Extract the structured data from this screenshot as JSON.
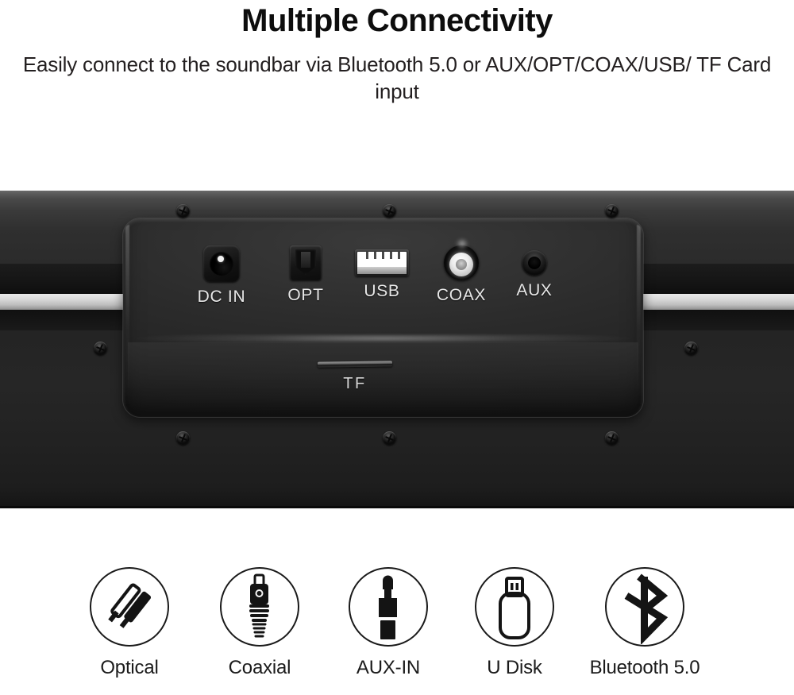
{
  "header": {
    "title": "Multiple Connectivity",
    "subtitle": "Easily connect to the soundbar via Bluetooth 5.0 or AUX/OPT/COAX/USB/ TF Card input"
  },
  "device": {
    "name": "soundbar-rear-panel",
    "ports": [
      {
        "id": "dc-in",
        "label": "DC IN",
        "icon": "dc-power-jack-icon"
      },
      {
        "id": "opt",
        "label": "OPT",
        "icon": "optical-toslink-port-icon"
      },
      {
        "id": "usb",
        "label": "USB",
        "icon": "usb-type-a-port-icon"
      },
      {
        "id": "coax",
        "label": "COAX",
        "icon": "rca-coaxial-jack-icon"
      },
      {
        "id": "aux",
        "label": "AUX",
        "icon": "aux-3-5mm-jack-icon"
      }
    ],
    "card_slot": {
      "id": "tf",
      "label": "TF",
      "icon": "tf-card-slot-icon"
    }
  },
  "connectivity_icons": [
    {
      "id": "optical",
      "label": "Optical",
      "icon": "optical-cable-icon"
    },
    {
      "id": "coaxial",
      "label": "Coaxial",
      "icon": "coaxial-plug-icon"
    },
    {
      "id": "aux-in",
      "label": "AUX-IN",
      "icon": "aux-plug-icon"
    },
    {
      "id": "u-disk",
      "label": "U Disk",
      "icon": "usb-flash-drive-icon"
    },
    {
      "id": "bluetooth",
      "label": "Bluetooth 5.0",
      "icon": "bluetooth-icon"
    }
  ],
  "colors": {
    "background": "#ffffff",
    "text": "#1b1b1b",
    "device_body": "#262626",
    "trim_strip": "#d8d8d8",
    "port_label": "#e8e8e8"
  }
}
